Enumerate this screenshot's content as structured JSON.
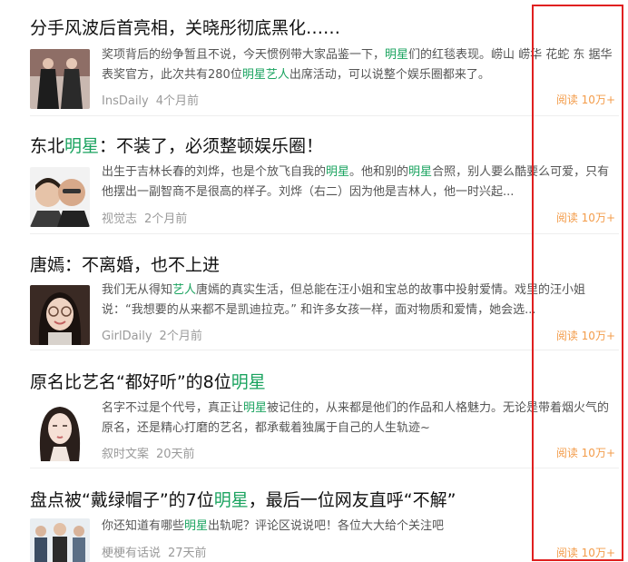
{
  "articles": [
    {
      "title_parts": [
        "分手风波后首亮相，关晓彤彻底黑化……"
      ],
      "snippet_parts": [
        "奖项背后的纷争暂且不说，今天惯例带大家品鉴一下，",
        "明星",
        "们的红毯表现。崂山 崂华 花蛇 东 据华表奖官方，此次共有280位",
        "明星艺人",
        "出席活动，可以说整个娱乐圈都来了。"
      ],
      "source": "InsDaily",
      "time": "4个月前",
      "reads": "阅读 10万+",
      "thumb": "two-women-red-carpet"
    },
    {
      "title_parts": [
        "东北",
        "明星",
        "：不装了，必须整顿娱乐圈！"
      ],
      "snippet_parts": [
        "出生于吉林长春的刘烨，也是个放飞自我的",
        "明星",
        "。他和别的",
        "明星",
        "合照，别人要么酷要么可爱，只有他摆出一副智商不是很高的样子。刘烨（右二）因为他是吉林人，他一时兴起..."
      ],
      "source": "视觉志",
      "time": "2个月前",
      "reads": "阅读 10万+",
      "thumb": "two-faces"
    },
    {
      "title_parts": [
        "唐嫣：不离婚，也不上进"
      ],
      "snippet_parts": [
        "我们无从得知",
        "艺人",
        "唐嫣的真实生活，但总能在汪小姐和宝总的故事中投射爱情。戏里的汪小姐说：“我想要的从来都不是凯迪拉克。” 和许多女孩一样，面对物质和爱情，她会选..."
      ],
      "source": "GirlDaily",
      "time": "2个月前",
      "reads": "阅读 10万+",
      "thumb": "woman-glasses"
    },
    {
      "title_parts": [
        "原名比艺名“都好听”的8位",
        "明星"
      ],
      "snippet_parts": [
        "名字不过是个代号，真正让",
        "明星",
        "被记住的，从来都是他们的作品和人格魅力。无论是带着烟火气的原名，还是精心打磨的艺名，都承载着独属于自己的人生轨迹~"
      ],
      "source": "叙时文案",
      "time": "20天前",
      "reads": "阅读 10万+",
      "thumb": "illustrated-woman"
    },
    {
      "title_parts": [
        "盘点被“戴绿帽子”的7位",
        "明星",
        "，最后一位网友直呼“不解”"
      ],
      "snippet_parts": [
        "你还知道有哪些",
        "明星",
        "出轨呢？评论区说说吧！各位大大给个关注吧"
      ],
      "source": "梗梗有话说",
      "time": "27天前",
      "reads": "阅读 10万+",
      "thumb": "group-men"
    }
  ],
  "colors": {
    "highlight": "#1aa35f",
    "reads": "#f39c4a",
    "annotation_box": "#e02020"
  }
}
